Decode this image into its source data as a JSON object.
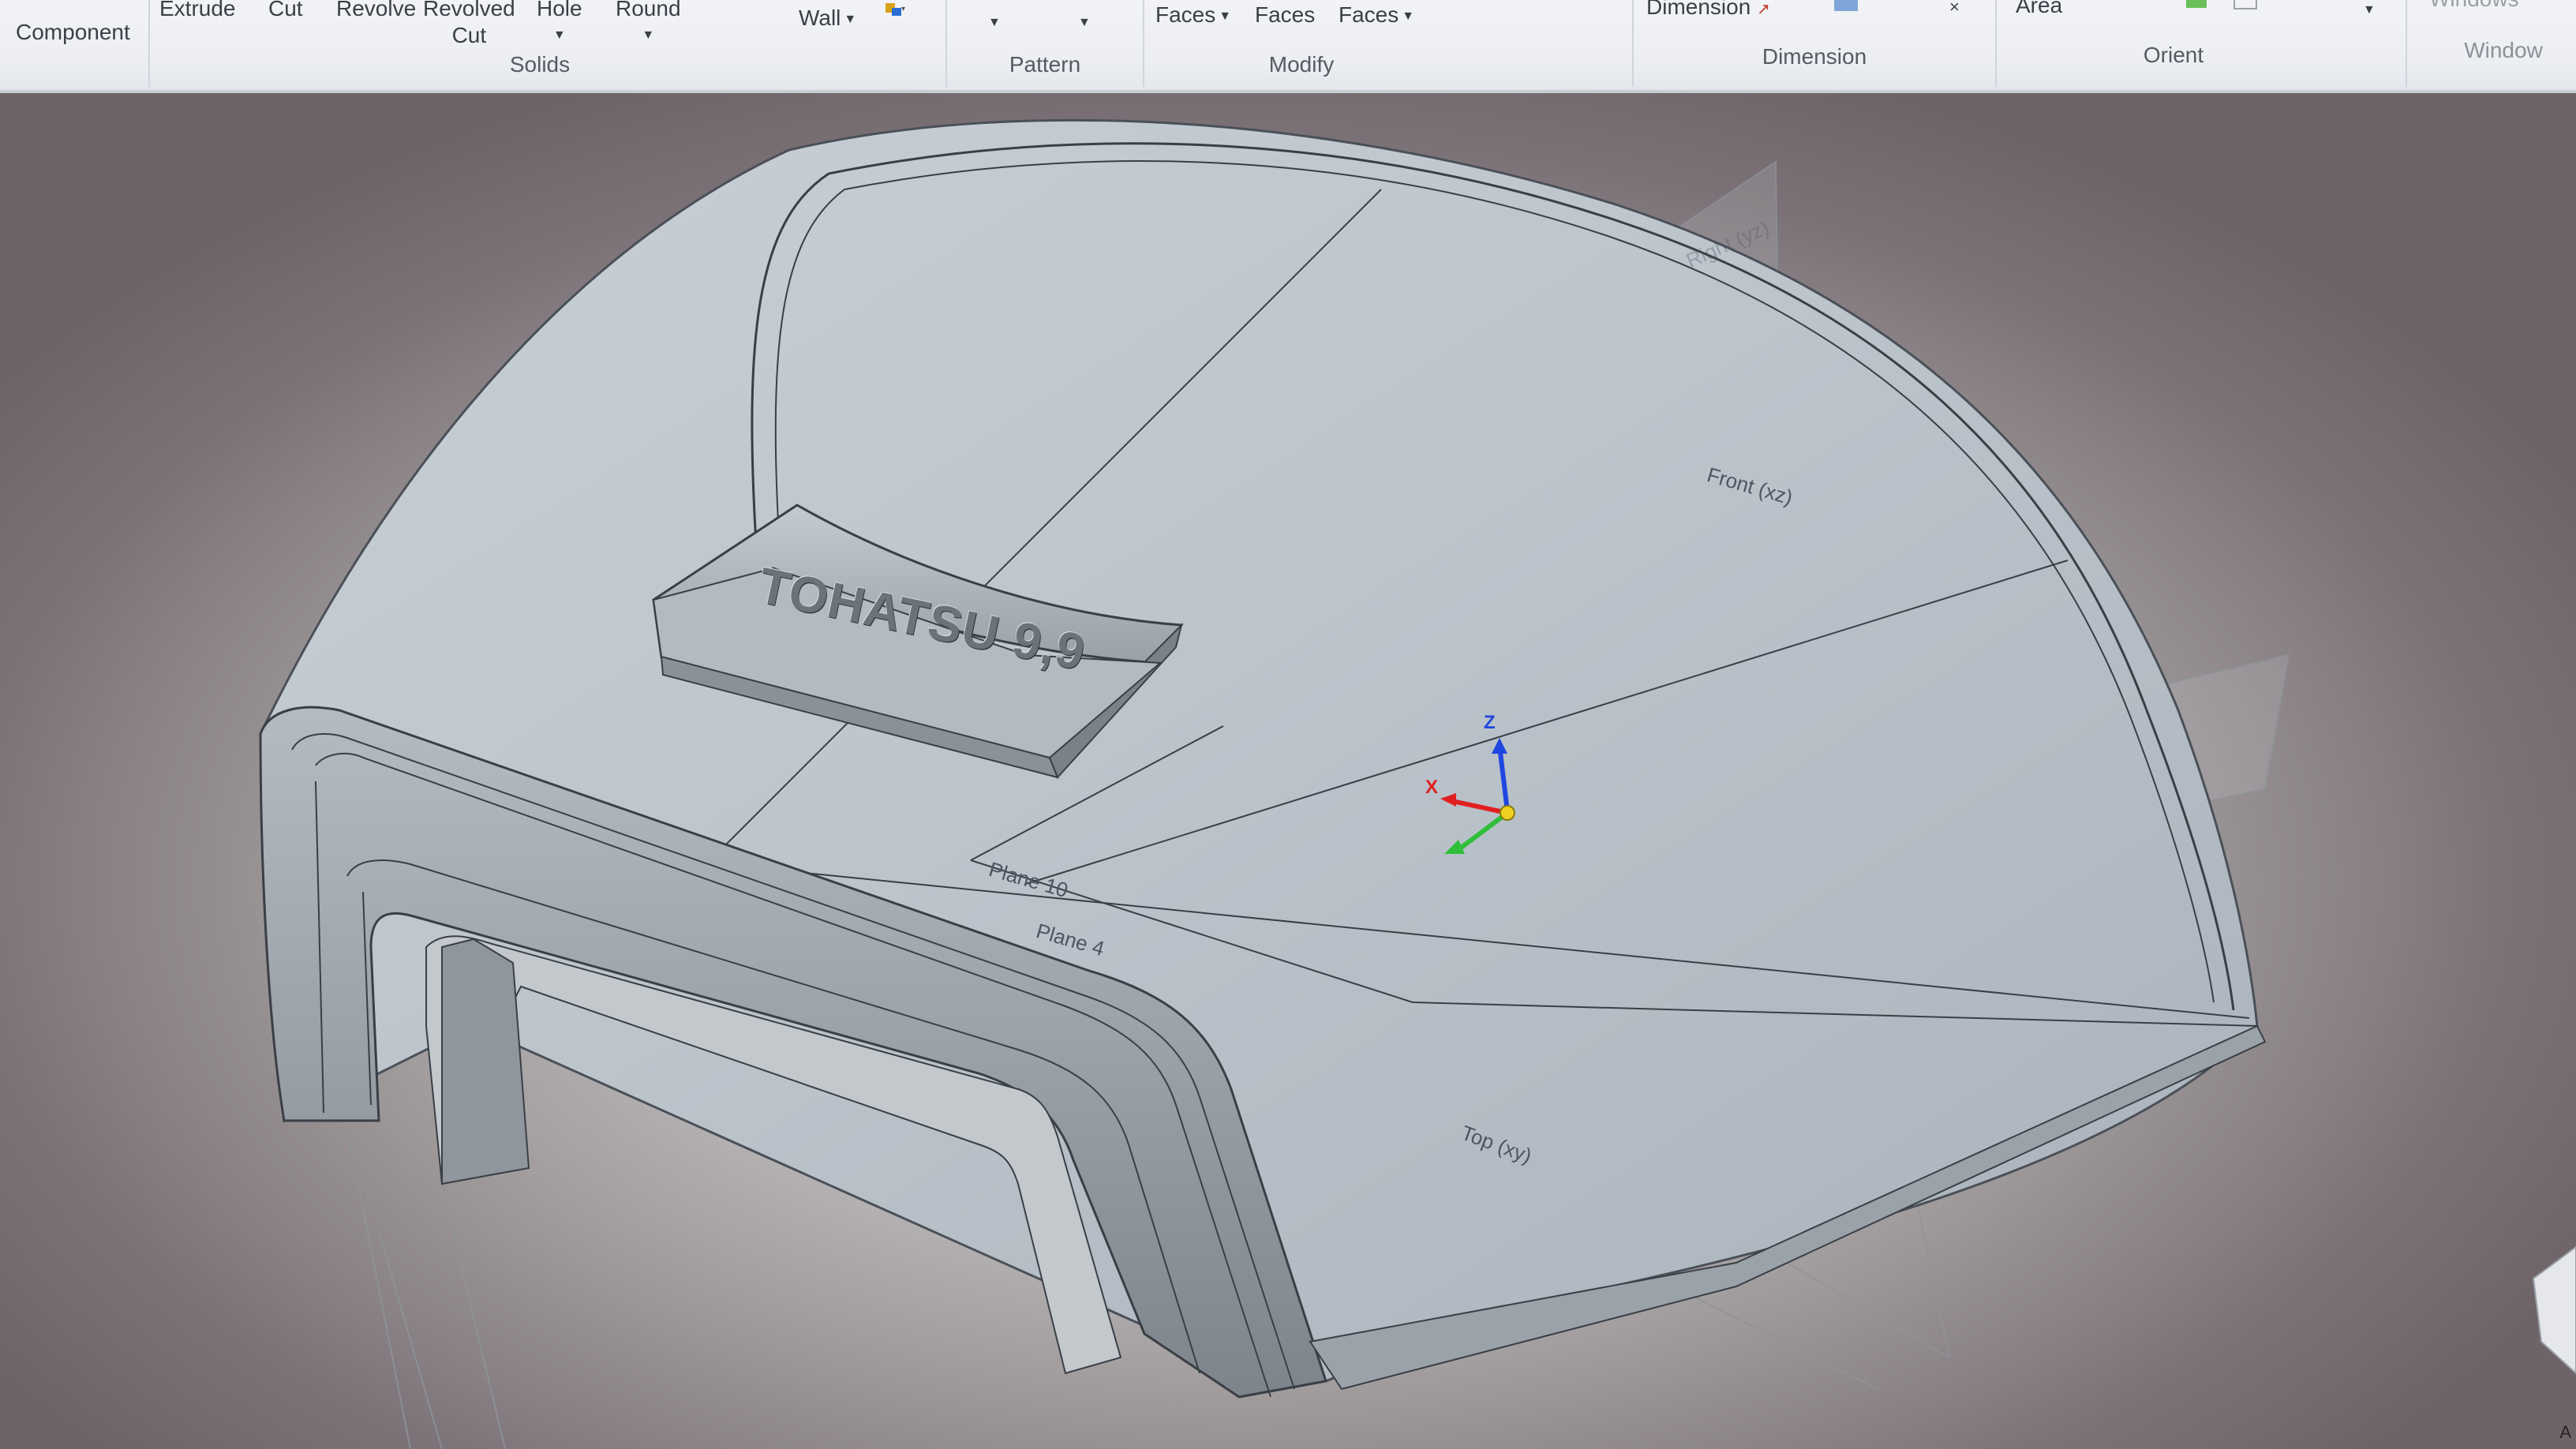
{
  "ribbon": {
    "groups": [
      {
        "key": "component",
        "label": "",
        "buttons": [
          "Component"
        ]
      },
      {
        "key": "solids",
        "label": "Solids",
        "buttons": [
          "Extrude",
          "Cut",
          "Revolve",
          "Revolved",
          "Cut",
          "Hole",
          "Round"
        ]
      },
      {
        "key": "shell",
        "label": "",
        "buttons": [
          "Wall"
        ]
      },
      {
        "key": "pattern",
        "label": "Pattern",
        "buttons": []
      },
      {
        "key": "modify",
        "label": "Modify",
        "buttons": [
          "Faces",
          "Faces",
          "Faces"
        ]
      },
      {
        "key": "dimension",
        "label": "Dimension",
        "buttons": [
          "Dimension"
        ]
      },
      {
        "key": "orient",
        "label": "Orient",
        "buttons": [
          "Area"
        ]
      },
      {
        "key": "window",
        "label": "Window",
        "buttons": [
          "Windows"
        ]
      }
    ]
  },
  "viewport": {
    "emboss_text": "TOHATSU 9,9",
    "planes": {
      "front": "Front (xz)",
      "plane10": "Plane 10",
      "plane4": "Plane 4",
      "top": "Top (xy)",
      "right": "Right (yz)"
    },
    "triad": {
      "z": "Z",
      "x": "X"
    },
    "corner": "A"
  },
  "colors": {
    "ribbon_bg": "#eceef2",
    "model_face": "#b9c1c9",
    "model_edge": "#3a3f46",
    "axis_x": "#e02020",
    "axis_y": "#2fbf3a",
    "axis_z": "#2046e0"
  }
}
